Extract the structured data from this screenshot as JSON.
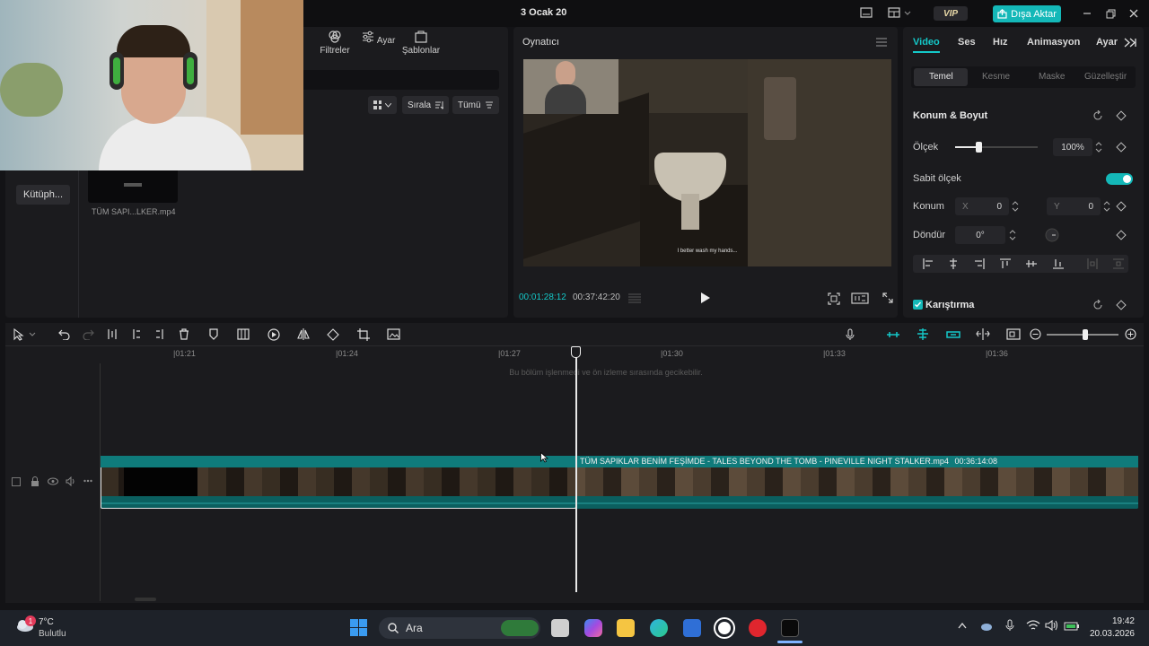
{
  "titlebar": {
    "project_title": "3 Ocak 20",
    "vip_label": "VIP",
    "export_label": "Dışa Aktar"
  },
  "media": {
    "tabs": [
      {
        "label": "Filtreler",
        "icon": "filters-icon"
      },
      {
        "label": "Ayar",
        "icon": "adjust-icon"
      },
      {
        "label": "Şablonlar",
        "icon": "templates-icon"
      }
    ],
    "sort_label": "Sırala",
    "filter_label": "Tümü",
    "library_label": "Kütüph...",
    "clip_name": "TÜM SAPI...LKER.mp4"
  },
  "player": {
    "title": "Oynatıcı",
    "subtitle": "I better wash my hands...",
    "current_time": "00:01:28:12",
    "total_time": "00:37:42:20"
  },
  "props": {
    "tabs": [
      {
        "label": "Video",
        "active": true
      },
      {
        "label": "Ses",
        "active": false
      },
      {
        "label": "Hız",
        "active": false
      },
      {
        "label": "Animasyon",
        "active": false
      },
      {
        "label": "Ayar",
        "active": false
      }
    ],
    "subtabs": [
      {
        "label": "Temel",
        "active": true
      },
      {
        "label": "Kesme",
        "active": false
      },
      {
        "label": "Maske",
        "active": false
      },
      {
        "label": "Güzelleştir",
        "active": false
      }
    ],
    "section_title": "Konum & Boyut",
    "scale_label": "Ölçek",
    "scale_value": "100%",
    "scale_level": 0.28,
    "uniform_scale_label": "Sabit ölçek",
    "uniform_scale_on": true,
    "position_label": "Konum",
    "x_label": "X",
    "x_value": "0",
    "y_label": "Y",
    "y_value": "0",
    "rotate_label": "Döndür",
    "rotate_value": "0°",
    "blend_label": "Karıştırma"
  },
  "timeline": {
    "ticks": [
      "|01:21",
      "|01:24",
      "|01:27",
      "|01:30",
      "|01:33",
      "|01:36"
    ],
    "notice": "Bu bölüm işlenmedi ve ön izleme sırasında gecikebilir.",
    "clip_title": "TÜM SAPIKLAR BENİM FEŞİMDE - TALES BEYOND THE TOMB - PINEVILLE NIGHT STALKER.mp4",
    "clip_duration": "00:36:14:08"
  },
  "taskbar": {
    "temperature": "7°C",
    "weather": "Bulutlu",
    "weather_badge": "1",
    "search_label": "Ara",
    "time": "19:42",
    "date": "20.03.2026"
  },
  "colors": {
    "accent": "#14b8b8",
    "panel": "#1b1b1e",
    "background": "#131316"
  }
}
